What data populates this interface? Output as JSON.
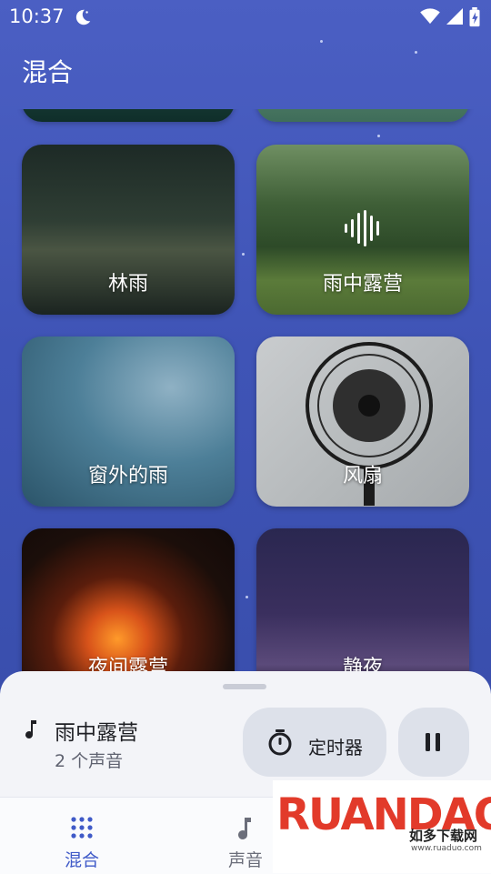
{
  "status_bar": {
    "time": "10:37"
  },
  "app_bar": {
    "title": "混合"
  },
  "cards": [
    {
      "label": "林雨"
    },
    {
      "label": "雨中露营",
      "playing": true
    },
    {
      "label": "窗外的雨"
    },
    {
      "label": "风扇"
    },
    {
      "label": "夜间露营"
    },
    {
      "label": "静夜"
    }
  ],
  "now_playing": {
    "title": "雨中露营",
    "subtitle": "2 个声音",
    "timer_label": "定时器"
  },
  "bottom_nav": {
    "items": [
      {
        "label": "混合",
        "active": true
      },
      {
        "label": "声音",
        "active": false
      }
    ]
  },
  "colors": {
    "accent": "#3f5ac8",
    "background": "#3f53b3"
  },
  "watermark": {
    "brand": "RUANDAO",
    "sub": "如多下载网",
    "url": "www.ruaduo.com"
  }
}
